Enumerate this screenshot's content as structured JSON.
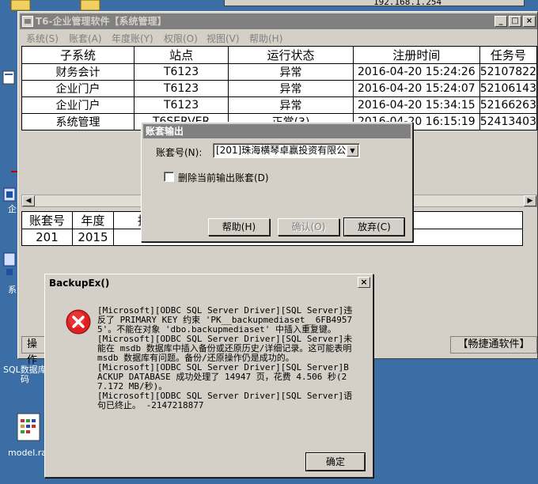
{
  "desktop": {
    "ip_text": "192.168.1.254",
    "icons": [
      {
        "label": "企"
      },
      {
        "label": "系"
      },
      {
        "label": "SQL数据库\n码"
      },
      {
        "label": "model.ra"
      }
    ]
  },
  "main_window": {
    "title": "T6-企业管理软件【系统管理】",
    "menu": [
      "系统(S)",
      "账套(A)",
      "年度账(Y)",
      "权限(O)",
      "视图(V)",
      "帮助(H)"
    ],
    "grid": {
      "headers": [
        "子系统",
        "站点",
        "运行状态",
        "注册时间",
        "任务号"
      ],
      "rows": [
        [
          "财务会计",
          "T6123",
          "异常",
          "2016-04-20 15:24:26",
          "52107822"
        ],
        [
          "企业门户",
          "T6123",
          "异常",
          "2016-04-20 15:24:07",
          "52106143"
        ],
        [
          "企业门户",
          "T6123",
          "异常",
          "2016-04-20 15:34:15",
          "52166263"
        ],
        [
          "系统管理",
          "T6SERVER",
          "正常(3)",
          "2016-04-20 16:15:19",
          "52413403"
        ]
      ]
    },
    "grid2": {
      "headers": [
        "账套号",
        "年度",
        "抄"
      ],
      "rows": [
        [
          "201",
          "2015",
          ""
        ]
      ]
    },
    "status_left": "操作",
    "status_right": "【畅捷通软件】"
  },
  "account_dialog": {
    "title": "账套输出",
    "account_label": "账套号(N):",
    "account_value": "[201]珠海横琴卓赢投资有限公",
    "delete_label": "删除当前输出账套(D)",
    "help_button": "帮助(H)",
    "ok_button": "确认(O)",
    "cancel_button": "放弃(C)"
  },
  "error_dialog": {
    "title": "BackupEx()",
    "messages": [
      "[Microsoft][ODBC SQL Server Driver][SQL Server]违反了 PRIMARY KEY 约束 'PK__backupmediaset__6FB49575'。不能在对象 'dbo.backupmediaset' 中插入重复键。",
      "[Microsoft][ODBC SQL Server Driver][SQL Server]未能在 msdb 数据库中插入备份或还原历史/详细记录。这可能表明 msdb 数据库有问题。备份/还原操作仍是成功的。",
      "[Microsoft][ODBC SQL Server Driver][SQL Server]BACKUP DATABASE 成功处理了 14947 页，花费 4.506 秒(27.172 MB/秒)。",
      "[Microsoft][ODBC SQL Server Driver][SQL Server]语句已终止。 -2147218877"
    ],
    "ok_button": "确定"
  }
}
